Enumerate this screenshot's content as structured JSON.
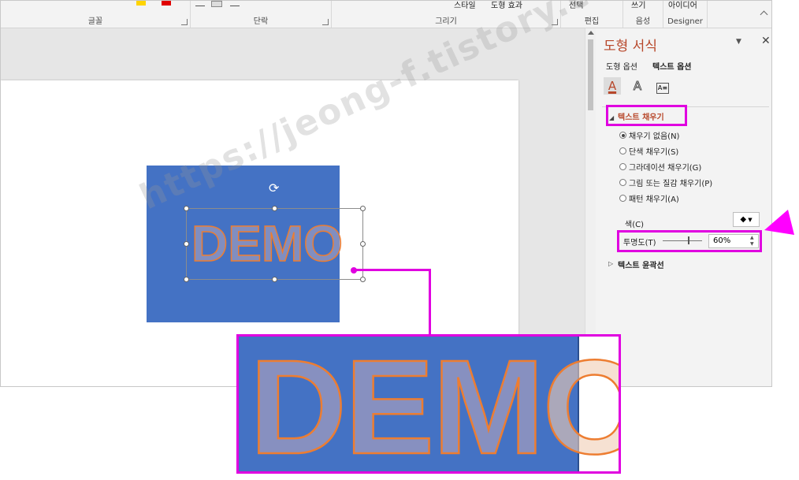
{
  "ribbon": {
    "groups": [
      {
        "label": "글꼴"
      },
      {
        "label": "단락"
      },
      {
        "label": "그리기"
      },
      {
        "label": "편집"
      },
      {
        "label": "음성"
      }
    ],
    "quick_style_label": "스타일",
    "shape_effects_label": "도형 효과",
    "select_label": "선택",
    "dictate_label": "쓰기",
    "designer_label": "아이디어",
    "designer_group": "Designer"
  },
  "slide": {
    "demo_text": "DEMO"
  },
  "zoom": {
    "demo_text_part": "DEM",
    "demo_text_o": "O"
  },
  "format_pane": {
    "title": "도형 서식",
    "tabs": [
      "도형 옵션",
      "텍스트 옵션"
    ],
    "active_tab": "텍스트 옵션",
    "icons": [
      "text-fill-outline-icon",
      "text-effects-icon",
      "textbox-icon"
    ],
    "section_text_fill": "텍스트 채우기",
    "fill_options": [
      {
        "label": "채우기 없음(N)",
        "checked": true
      },
      {
        "label": "단색 채우기(S)",
        "checked": false
      },
      {
        "label": "그라데이션 채우기(G)",
        "checked": false
      },
      {
        "label": "그림 또는 질감 채우기(P)",
        "checked": false
      },
      {
        "label": "패턴 채우기(A)",
        "checked": false
      }
    ],
    "color_label": "색(C)",
    "transparency_label": "투명도(T)",
    "transparency_value": "60%",
    "transparency_fraction": 0.6,
    "section_text_outline": "텍스트 윤곽선"
  },
  "watermark": "https://jeong-f.tistory.com",
  "colors": {
    "accent": "#b7472a",
    "highlight": "#e000e0",
    "shape_fill": "#4472c4",
    "text_outline": "#ed7d31"
  }
}
